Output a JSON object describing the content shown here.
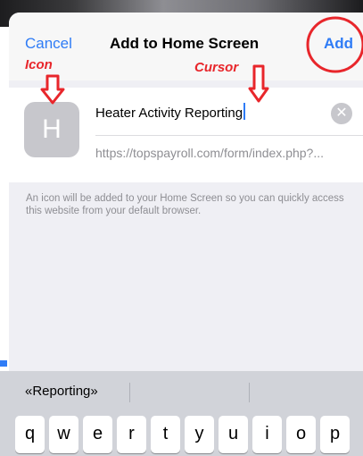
{
  "nav": {
    "cancel_label": "Cancel",
    "title": "Add to Home Screen",
    "add_label": "Add"
  },
  "form": {
    "icon_letter": "H",
    "name_value": "Heater Activity Reporting",
    "clear_glyph": "✕",
    "url": "https://topspayroll.com/form/index.php?..."
  },
  "help_text": "An icon will be added to your Home Screen so you can quickly access this website from your default browser.",
  "keyboard": {
    "suggestions": [
      "«Reporting»",
      "",
      ""
    ],
    "row1": [
      "q",
      "w",
      "e",
      "r",
      "t",
      "y",
      "u",
      "i",
      "o",
      "p"
    ]
  },
  "annotations": {
    "icon_label": "Icon",
    "cursor_label": "Cursor",
    "color": "#e8262b"
  },
  "colors": {
    "accent": "#2f7cf6",
    "annotation": "#e8262b"
  }
}
